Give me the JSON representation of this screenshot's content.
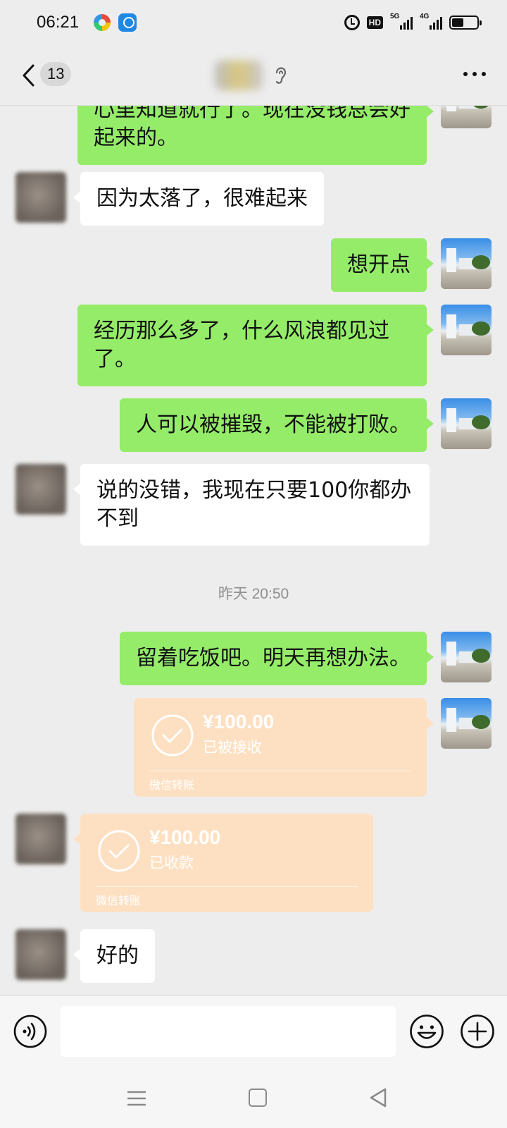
{
  "status_bar": {
    "time": "06:21",
    "icons": [
      "color-circle-app-icon",
      "blue-app-icon",
      "alarm-icon",
      "hd-voice-icon",
      "5g-signal-icon",
      "4g-signal-icon",
      "battery-icon"
    ],
    "hd_label": "HD",
    "net1": "5G",
    "net2": "4G"
  },
  "header": {
    "unread_count": "13",
    "icons": [
      "back-icon",
      "ear-icon",
      "more-icon"
    ]
  },
  "messages": [
    {
      "from": "me",
      "text": "心里知道就行了。现在没钱总会好起来的。"
    },
    {
      "from": "other",
      "text": "因为太落了，很难起来"
    },
    {
      "from": "me",
      "text": "想开点"
    },
    {
      "from": "me",
      "text": "经历那么多了，什么风浪都见过了。"
    },
    {
      "from": "me",
      "text": "人可以被摧毁，不能被打败。"
    },
    {
      "from": "other",
      "text": "说的没错，我现在只要100你都办不到"
    },
    {
      "type": "timestamp",
      "text": "昨天 20:50"
    },
    {
      "from": "me",
      "text": "留着吃饭吧。明天再想办法。"
    },
    {
      "from": "me",
      "type": "transfer",
      "amount": "¥100.00",
      "status": "已被接收",
      "footer": "微信转账"
    },
    {
      "from": "other",
      "type": "transfer",
      "amount": "¥100.00",
      "status": "已收款",
      "footer": "微信转账"
    },
    {
      "from": "other",
      "text": "好的"
    }
  ],
  "input_bar": {
    "text_value": "",
    "icons": [
      "voice-icon",
      "emoji-icon",
      "plus-icon"
    ]
  },
  "nav_bar": {
    "icons": [
      "menu-icon",
      "home-icon",
      "back-triangle-icon"
    ]
  },
  "colors": {
    "my_bubble": "#95ec69",
    "other_bubble": "#ffffff",
    "transfer_bubble": "#fde0c2",
    "background": "#ededed"
  }
}
